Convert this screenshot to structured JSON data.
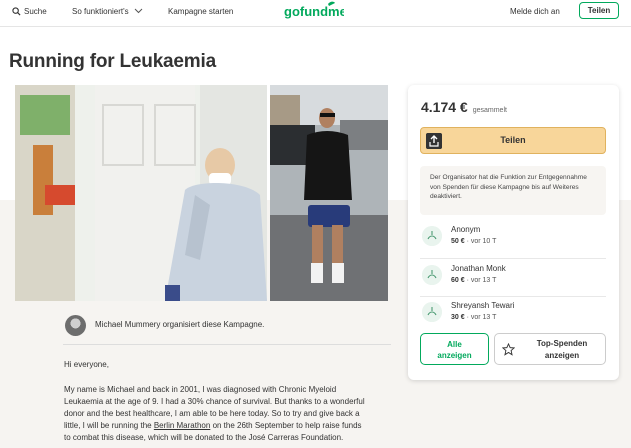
{
  "header": {
    "search": "Suche",
    "how": "So funktioniert's",
    "start": "Kampagne starten",
    "logo": "gofundme",
    "login": "Melde dich an",
    "share": "Teilen"
  },
  "page": {
    "title": "Running for Leukaemia"
  },
  "card": {
    "amount": "4.174 €",
    "amount_label": "gesammelt",
    "share": "Teilen",
    "notice": "Der Organisator hat die Funktion zur Entgegennahme von Spenden für diese Kampagne bis auf Weiteres deaktiviert.",
    "donors": [
      {
        "name": "Anonym",
        "amount": "50 €",
        "dot": "·",
        "time": "vor 10 T"
      },
      {
        "name": "Jonathan Monk",
        "amount": "60 €",
        "dot": "·",
        "time": "vor 13 T"
      },
      {
        "name": "Shreyansh Tewari",
        "amount": "30 €",
        "dot": "·",
        "time": "vor 13 T"
      }
    ],
    "all_1": "Alle",
    "all_2": "anzeigen",
    "top_1": "Top-Spenden",
    "top_2": "anzeigen"
  },
  "organizer": {
    "text": "Michael Mummery organisiert diese Kampagne."
  },
  "story": {
    "greeting": "Hi everyone,",
    "l1": "My name is Michael and back in 2001, I was diagnosed with Chronic Myeloid",
    "l2": "Leukaemia at the age of 9. I had a 30% chance of survival. But thanks to a wonderful",
    "l3": "donor and the best healthcare, I am able to be here today. So to try and give back a",
    "l4_a": "little, I will be running the",
    "l4_link": "Berlin Marathon",
    "l4_b": "on the 26th September to help raise funds",
    "l5": "to combat this disease, which will be donated to the José Carreras Foundation."
  },
  "colors": {
    "brand": "#02a95c",
    "share_button": "#f8d69a"
  }
}
